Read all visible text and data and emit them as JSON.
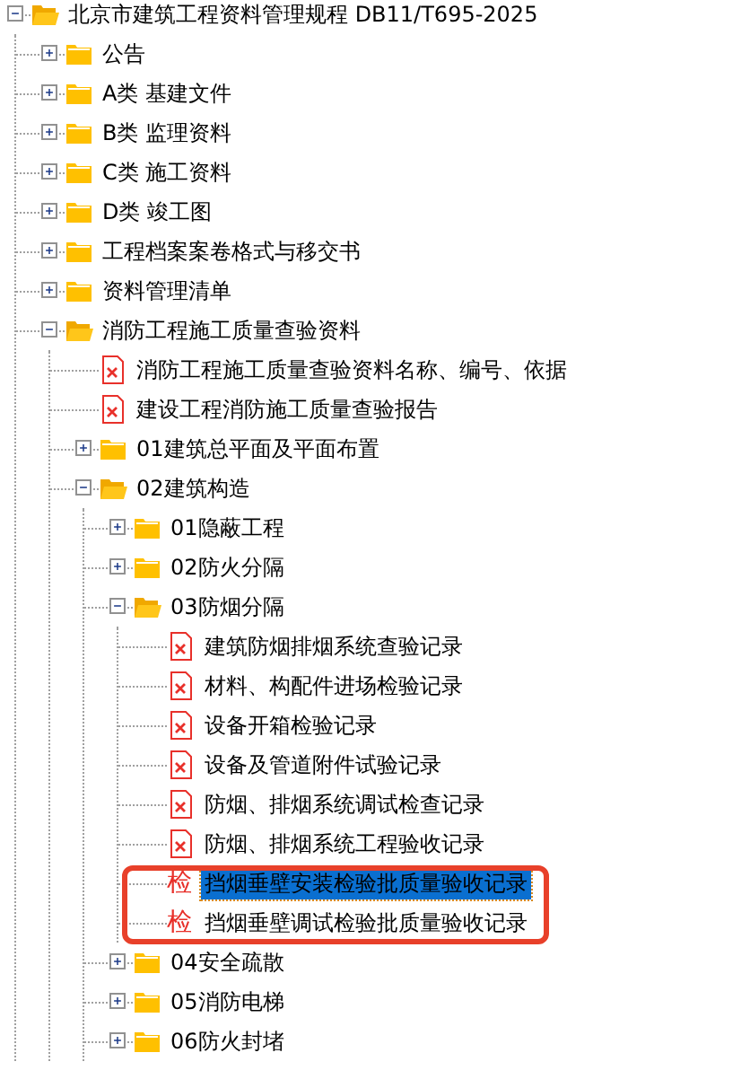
{
  "tree": {
    "nodes": [
      {
        "label": "北京市建筑工程资料管理规程 DB11/T695-2025",
        "kind": "folder",
        "expanded": true,
        "selected": false,
        "children": [
          {
            "label": "公告",
            "kind": "folder",
            "expanded": false,
            "selected": false
          },
          {
            "label": "A类 基建文件",
            "kind": "folder",
            "expanded": false,
            "selected": false
          },
          {
            "label": "B类 监理资料",
            "kind": "folder",
            "expanded": false,
            "selected": false
          },
          {
            "label": "C类 施工资料",
            "kind": "folder",
            "expanded": false,
            "selected": false
          },
          {
            "label": "D类 竣工图",
            "kind": "folder",
            "expanded": false,
            "selected": false
          },
          {
            "label": "工程档案案卷格式与移交书",
            "kind": "folder",
            "expanded": false,
            "selected": false
          },
          {
            "label": "资料管理清单",
            "kind": "folder",
            "expanded": false,
            "selected": false
          },
          {
            "label": "消防工程施工质量查验资料",
            "kind": "folder",
            "expanded": true,
            "selected": false,
            "children": [
              {
                "label": "消防工程施工质量查验资料名称、编号、依据",
                "kind": "xls",
                "selected": false
              },
              {
                "label": "建设工程消防施工质量查验报告",
                "kind": "xls",
                "selected": false
              },
              {
                "label": "01建筑总平面及平面布置",
                "kind": "folder",
                "expanded": false,
                "selected": false
              },
              {
                "label": "02建筑构造",
                "kind": "folder",
                "expanded": true,
                "selected": false,
                "children": [
                  {
                    "label": "01隐蔽工程",
                    "kind": "folder",
                    "expanded": false,
                    "selected": false
                  },
                  {
                    "label": "02防火分隔",
                    "kind": "folder",
                    "expanded": false,
                    "selected": false
                  },
                  {
                    "label": "03防烟分隔",
                    "kind": "folder",
                    "expanded": true,
                    "selected": false,
                    "children": [
                      {
                        "label": "建筑防烟排烟系统查验记录",
                        "kind": "xls",
                        "selected": false,
                        "outlined": false
                      },
                      {
                        "label": "材料、构配件进场检验记录",
                        "kind": "xls",
                        "selected": false,
                        "outlined": false
                      },
                      {
                        "label": "设备开箱检验记录",
                        "kind": "xls",
                        "selected": false,
                        "outlined": false
                      },
                      {
                        "label": "设备及管道附件试验记录",
                        "kind": "xls",
                        "selected": false,
                        "outlined": false
                      },
                      {
                        "label": "防烟、排烟系统调试检查记录",
                        "kind": "xls",
                        "selected": false,
                        "outlined": false
                      },
                      {
                        "label": "防烟、排烟系统工程验收记录",
                        "kind": "xls",
                        "selected": false,
                        "outlined": false
                      },
                      {
                        "label": "挡烟垂壁安装检验批质量验收记录",
                        "kind": "form",
                        "icon_text": "检",
                        "selected": true,
                        "outlined": true
                      },
                      {
                        "label": "挡烟垂壁调试检验批质量验收记录",
                        "kind": "form",
                        "icon_text": "检",
                        "selected": false,
                        "outlined": true
                      }
                    ]
                  },
                  {
                    "label": "04安全疏散",
                    "kind": "folder",
                    "expanded": false,
                    "selected": false
                  },
                  {
                    "label": "05消防电梯",
                    "kind": "folder",
                    "expanded": false,
                    "selected": false
                  },
                  {
                    "label": "06防火封堵",
                    "kind": "folder",
                    "expanded": false,
                    "selected": false
                  }
                ]
              }
            ]
          }
        ]
      }
    ]
  }
}
